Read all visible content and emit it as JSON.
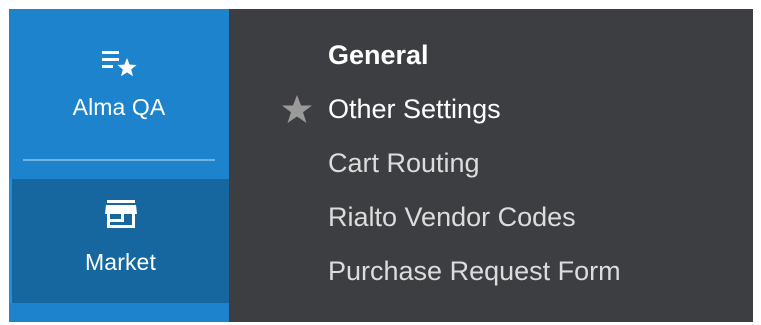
{
  "sidebar": {
    "items": [
      {
        "label": "Alma QA",
        "icon": "list-star-icon",
        "active": false
      },
      {
        "label": "Market",
        "icon": "storefront-icon",
        "active": true
      }
    ]
  },
  "menu": {
    "items": [
      {
        "label": "General",
        "bold": true,
        "favorite": false
      },
      {
        "label": "Other Settings",
        "bold": false,
        "favorite": true
      },
      {
        "label": "Cart Routing",
        "bold": false,
        "favorite": false
      },
      {
        "label": "Rialto Vendor Codes",
        "bold": false,
        "favorite": false
      },
      {
        "label": "Purchase Request Form",
        "bold": false,
        "favorite": false
      }
    ],
    "star_icon": "star-icon"
  },
  "colors": {
    "sidebar_bg": "#1c83cc",
    "sidebar_active_bg": "#16679f",
    "menu_bg": "#3d3e42",
    "menu_text": "#dcdcdc",
    "star": "#9a9a9a"
  }
}
